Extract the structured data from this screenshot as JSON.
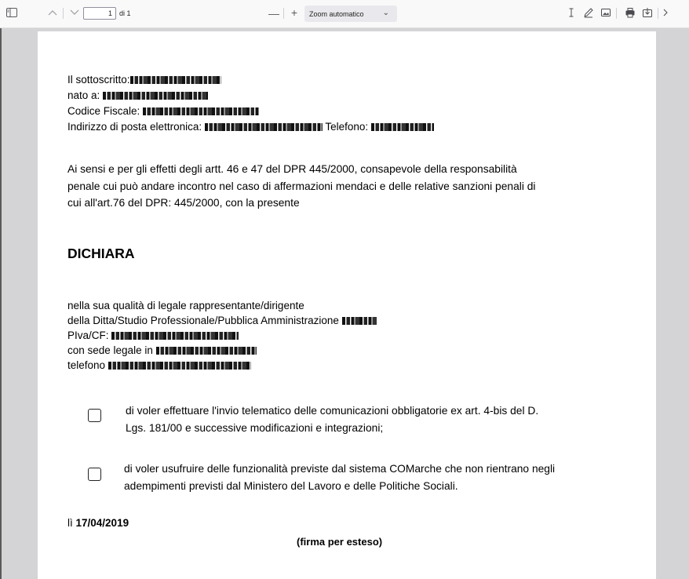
{
  "toolbar": {
    "page_current": "1",
    "page_total": "di 1",
    "zoom_out_label": "—",
    "zoom_in_label": "+",
    "zoom_value": "Zoom automatico",
    "icons": [
      "sidebar-toggle-icon",
      "chevron-up-icon",
      "chevron-down-icon",
      "zoom-out-icon",
      "zoom-in-icon",
      "text-cursor-icon",
      "pen-icon",
      "image-icon",
      "print-icon",
      "save-icon",
      "overflow-chevron-icon"
    ]
  },
  "document": {
    "sottoscritto_label": "Il sottoscritto:",
    "nato_label": "nato a:",
    "cf_label": "Codice Fiscale:",
    "email_label": "Indirizzo di posta elettronica:",
    "telefono_label": "Telefono:",
    "intro_line1": "Ai sensi e per gli effetti degli artt. 46 e 47 del DPR 445/2000, consapevole della responsabilità",
    "intro_line2": "penale cui può andare incontro nel caso di affermazioni mendaci e delle relative sanzioni penali di",
    "intro_line3": "cui all'art.76 del DPR: 445/2000, con la presente",
    "heading": "DICHIARA",
    "quality_line1": "nella sua qualità di legale rappresentante/dirigente",
    "quality_line2": " della Ditta/Studio Professionale/Pubblica Amministrazione",
    "piva_label": "PIva/CF:",
    "sede_label": "con sede legale in",
    "telefono2_label": "telefono",
    "option1_line1": "di voler effettuare l'invio telematico delle comunicazioni obbligatorie ex art. 4-bis del D.",
    "option1_line2": "Lgs. 181/00 e successive modificazioni e integrazioni;",
    "option2_line1": "di voler usufruire delle funzionalità previste dal sistema COMarche che non rientrano negli",
    "option2_line2": "adempimenti previsti dal Ministero del Lavoro e delle Politiche Sociali.",
    "date_prefix": "lì ",
    "date_value": "17/04/2019",
    "signature": "(firma per esteso)"
  }
}
